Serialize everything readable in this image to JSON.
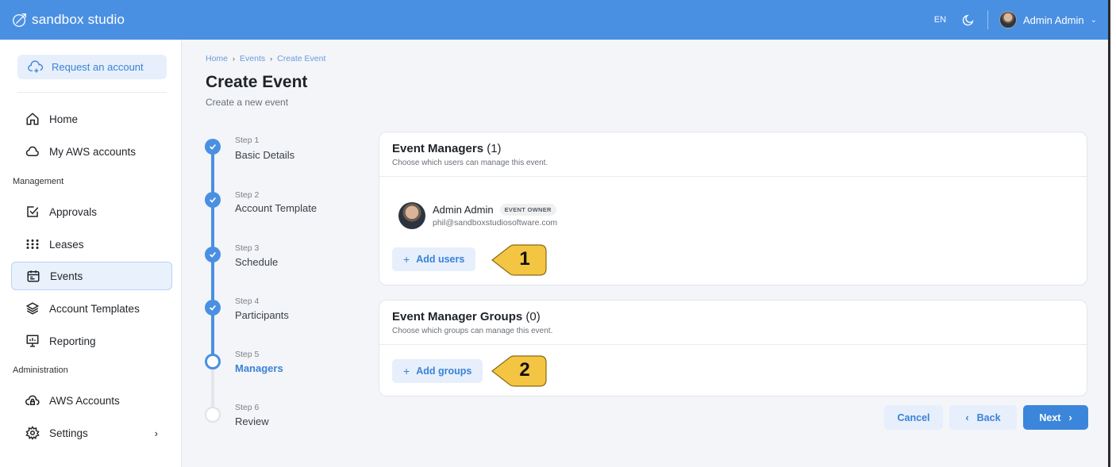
{
  "app": {
    "name": "sandbox studio"
  },
  "topbar": {
    "language": "EN",
    "user_name": "Admin Admin"
  },
  "sidebar": {
    "request_account_label": "Request an account",
    "items": [
      {
        "label": "Home",
        "icon": "home-icon"
      },
      {
        "label": "My AWS accounts",
        "icon": "cloud-icon"
      },
      {
        "label": "Approvals",
        "icon": "approval-check-icon"
      },
      {
        "label": "Leases",
        "icon": "grid-dots-icon"
      },
      {
        "label": "Events",
        "icon": "calendar-icon",
        "active": true
      },
      {
        "label": "Account Templates",
        "icon": "layers-icon"
      },
      {
        "label": "Reporting",
        "icon": "presentation-icon"
      },
      {
        "label": "AWS Accounts",
        "icon": "cloud-lock-icon"
      },
      {
        "label": "Settings",
        "icon": "gear-icon"
      }
    ],
    "sections": {
      "management": "Management",
      "administration": "Administration"
    }
  },
  "breadcrumb": [
    "Home",
    "Events",
    "Create Event"
  ],
  "page": {
    "title": "Create Event",
    "subtitle": "Create a new event"
  },
  "steps": [
    {
      "num": "Step 1",
      "label": "Basic Details",
      "state": "done"
    },
    {
      "num": "Step 2",
      "label": "Account Template",
      "state": "done"
    },
    {
      "num": "Step 3",
      "label": "Schedule",
      "state": "done"
    },
    {
      "num": "Step 4",
      "label": "Participants",
      "state": "done"
    },
    {
      "num": "Step 5",
      "label": "Managers",
      "state": "current"
    },
    {
      "num": "Step 6",
      "label": "Review",
      "state": "todo"
    }
  ],
  "managers_card": {
    "title": "Event Managers",
    "count": "(1)",
    "description": "Choose which users can manage this event.",
    "manager": {
      "name": "Admin Admin",
      "badge": "EVENT OWNER",
      "email": "phil@sandboxstudiosoftware.com"
    },
    "add_label": "Add users",
    "callout": "1"
  },
  "groups_card": {
    "title": "Event Manager Groups",
    "count": "(0)",
    "description": "Choose which groups can manage this event.",
    "add_label": "Add groups",
    "callout": "2"
  },
  "actions": {
    "cancel": "Cancel",
    "back": "Back",
    "next": "Next"
  },
  "colors": {
    "topbar": "#4a90e2",
    "accent": "#3b82d6",
    "button_bg": "#e6effb",
    "callout": "#f4c542"
  }
}
